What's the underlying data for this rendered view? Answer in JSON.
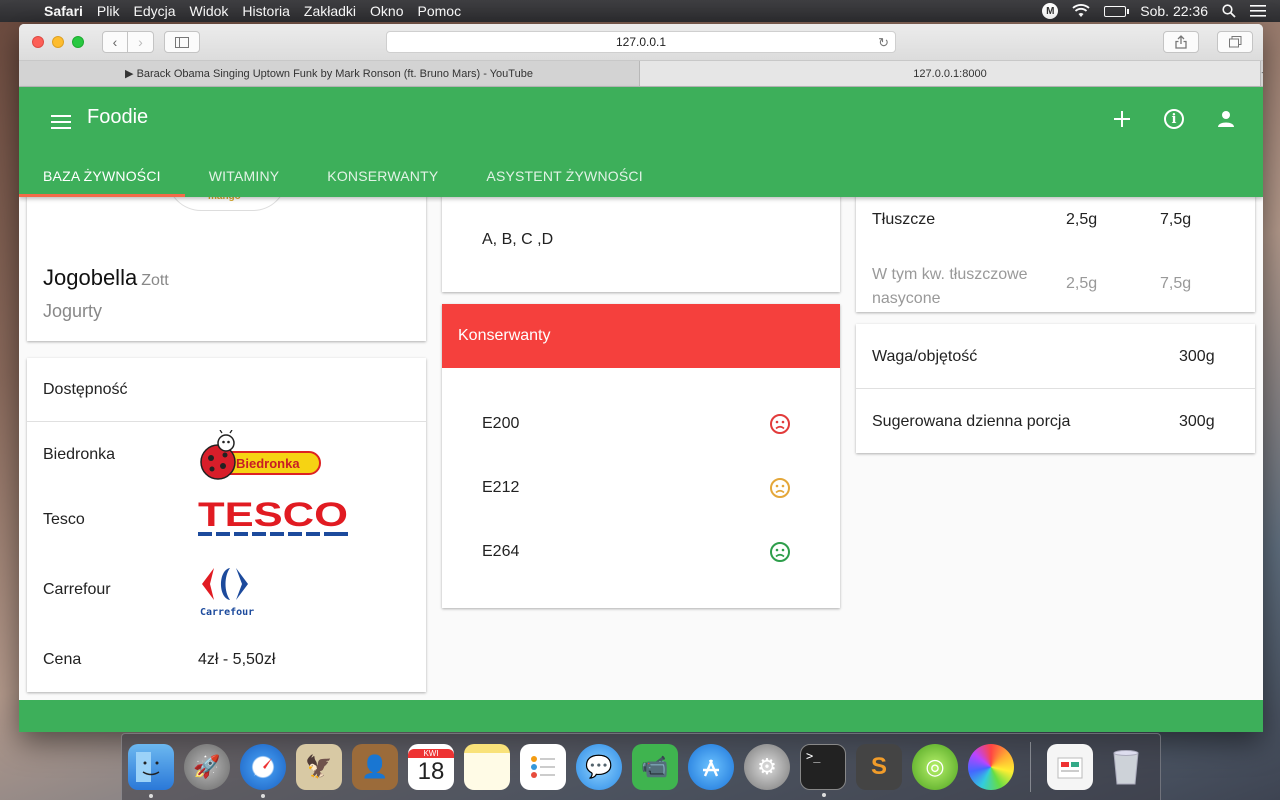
{
  "menubar": {
    "items": [
      "Safari",
      "Plik",
      "Edycja",
      "Widok",
      "Historia",
      "Zakładki",
      "Okno",
      "Pomoc"
    ],
    "clock": "Sob. 22:36",
    "status_badge": "M"
  },
  "browser": {
    "url": "127.0.0.1",
    "tabs": [
      {
        "label": "▶ Barack Obama Singing Uptown Funk by Mark Ronson (ft. Bruno Mars) - YouTube"
      },
      {
        "label": "127.0.0.1:8000"
      }
    ],
    "new_tab": "+"
  },
  "app": {
    "title": "Foodie",
    "nav_tabs": [
      "BAZA ŻYWNOŚCI",
      "WITAMINY",
      "KONSERWANTY",
      "ASYSTENT ŻYWNOŚCI"
    ],
    "accent_color": "#3daf5a"
  },
  "product": {
    "image_text": "mango",
    "name": "Jogobella",
    "brand": "Zott",
    "category": "Jogurty"
  },
  "availability": {
    "title": "Dostępność",
    "stores": [
      {
        "name": "Biedronka",
        "logo_text": "Biedronka"
      },
      {
        "name": "Tesco",
        "logo_text": "TESCO"
      },
      {
        "name": "Carrefour",
        "logo_text": "Carrefour"
      }
    ],
    "price_label": "Cena",
    "price_value": "4zł - 5,50zł"
  },
  "vitamins": {
    "list": "A, B, C ,D"
  },
  "preservatives": {
    "title": "Konserwanty",
    "header_color": "#f5403d",
    "items": [
      {
        "code": "E200",
        "rating": "bad",
        "icon": "sad-face-icon",
        "color": "#e23b3b"
      },
      {
        "code": "E212",
        "rating": "medium",
        "icon": "sad-face-icon",
        "color": "#e4a73a"
      },
      {
        "code": "E264",
        "rating": "good",
        "icon": "sad-face-icon",
        "color": "#2e9e4b"
      }
    ]
  },
  "nutrition": {
    "rows": [
      {
        "label": "Tłuszcze",
        "per_100": "2,5g",
        "per_portion": "7,5g"
      },
      {
        "label": "W tym kw. tłuszczowe nasycone",
        "per_100": "2,5g",
        "per_portion": "7,5g"
      }
    ]
  },
  "portion": {
    "weight_label": "Waga/objętość",
    "weight_value": "300g",
    "daily_label": "Sugerowana dzienna porcja",
    "daily_value": "300g"
  },
  "dock": {
    "calendar_month": "KWI",
    "calendar_day": "18"
  }
}
